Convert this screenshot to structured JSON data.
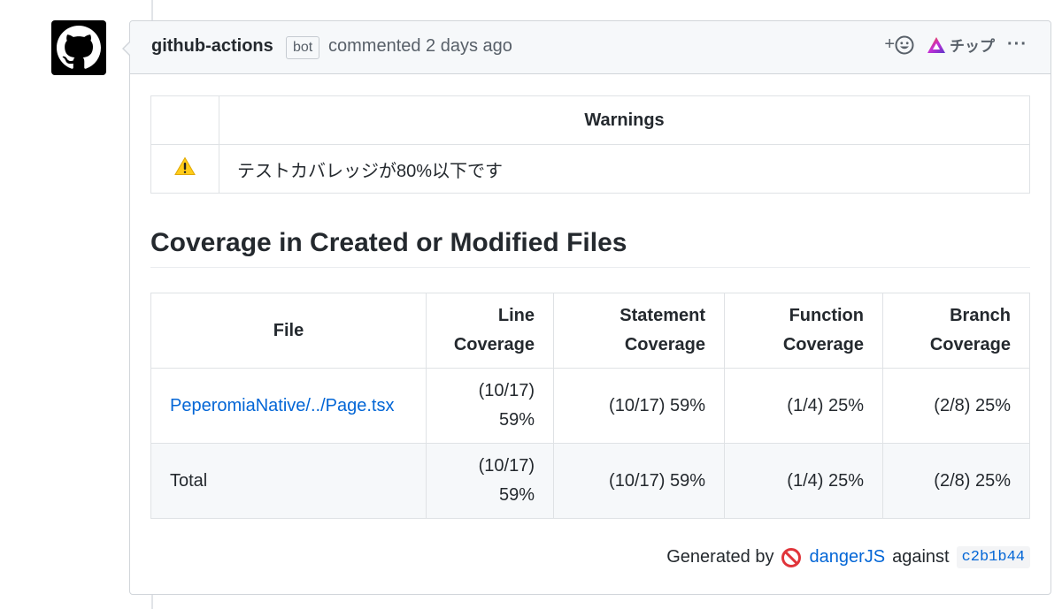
{
  "comment": {
    "author": "github-actions",
    "badge": "bot",
    "timestamp": "commented 2 days ago",
    "reaction_label": "+",
    "tip_label": "チップ",
    "more_label": "···"
  },
  "warnings": {
    "header": "Warnings",
    "rows": [
      {
        "icon": "warning-icon",
        "text": "テストカバレッジが80%以下です"
      }
    ]
  },
  "coverage": {
    "title": "Coverage in Created or Modified Files",
    "headers": [
      "File",
      "Line Coverage",
      "Statement Coverage",
      "Function Coverage",
      "Branch Coverage"
    ],
    "rows": [
      {
        "file": "PeperomiaNative/../Page.tsx",
        "line": "(10/17) 59%",
        "statement": "(10/17) 59%",
        "function": "(1/4) 25%",
        "branch": "(2/8) 25%"
      }
    ],
    "total": {
      "file": "Total",
      "line": "(10/17) 59%",
      "statement": "(10/17) 59%",
      "function": "(1/4) 25%",
      "branch": "(2/8) 25%"
    }
  },
  "footer": {
    "generated_by": "Generated by",
    "tool": "dangerJS",
    "against": "against",
    "sha": "c2b1b44"
  },
  "colors": {
    "link": "#0366d6",
    "border": "#d1d5da",
    "header_bg": "#f6f8fa"
  }
}
